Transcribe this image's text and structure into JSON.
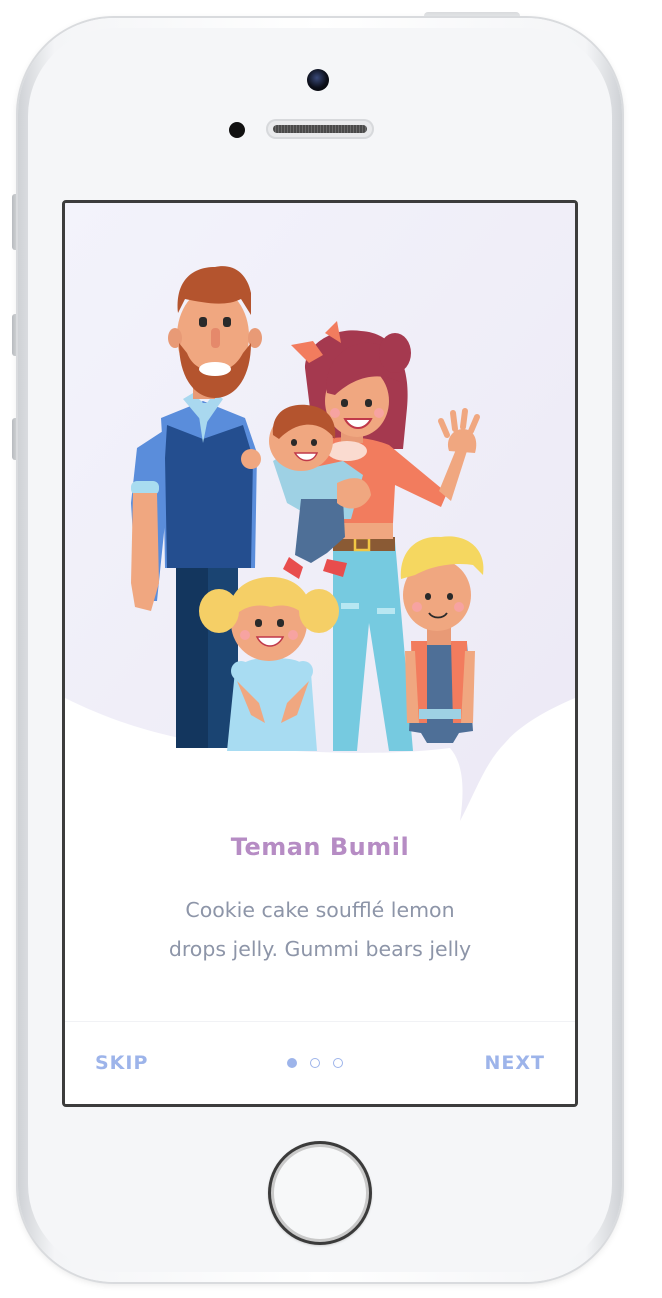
{
  "onboarding": {
    "title": "Teman Bumil",
    "description_line1": "Cookie cake soufflé lemon",
    "description_line2": "drops jelly. Gummi bears jelly",
    "skip_label": "SKIP",
    "next_label": "NEXT",
    "page_indicator": {
      "current": 1,
      "total": 3
    }
  },
  "colors": {
    "title": "#b68cc4",
    "text": "#8d95a8",
    "accent": "#9db4ea",
    "hero_bg": "#eeeef8"
  },
  "icons": [
    "front-camera-icon",
    "speaker-grille-icon",
    "home-button-icon",
    "family-illustration"
  ]
}
